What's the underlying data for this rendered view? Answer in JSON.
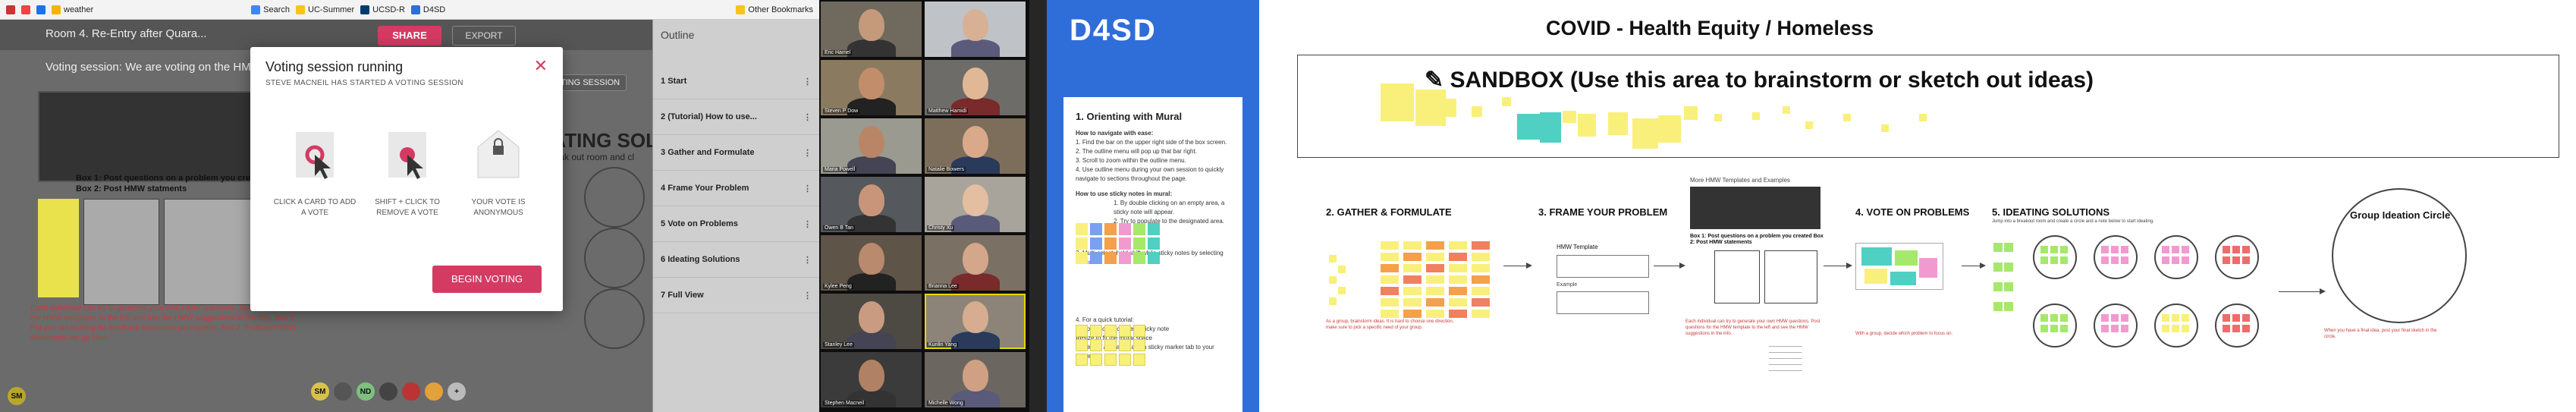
{
  "browser": {
    "bookmarks": [
      "weather",
      "Search",
      "UC-Summer",
      "UCSD-R",
      "D4SD"
    ],
    "other_bookmarks": "Other Bookmarks"
  },
  "mural_left": {
    "room_title": "Room 4. Re-Entry after Quara...",
    "share_label": "SHARE",
    "export_label": "EXPORT",
    "voting_banner": "Voting session: We are voting on the HMW ...",
    "voting_session_btn": "VOTING SESSION",
    "ideating_text": "EATING SOLU",
    "breakout_text": "break out room and cl",
    "box_labels": [
      "Box 1: Post questions on a problem you create",
      "Box 2: Post HMW statments"
    ],
    "red_note": "Each individual can try to generate your own HMW questions. Now vote Select the HMW templates to the left and use the HMW suggestions in the info. Box 1: Put you are looking for feedback from other participants. Box 2: Finalized HMW statements we go here",
    "avatars": [
      "SM",
      "",
      "ND",
      "",
      "",
      "",
      "+"
    ],
    "user_initials": "SM"
  },
  "outline": {
    "title": "Outline",
    "items": [
      "Start",
      "(Tutorial) How to use...",
      "Gather and Formulate",
      "Frame Your Problem",
      "Vote on Problems",
      "Ideating Solutions",
      "Full View"
    ],
    "numbers": [
      "1",
      "2",
      "3",
      "4",
      "5",
      "6",
      "7"
    ]
  },
  "modal": {
    "title": "Voting session running",
    "subtitle": "STEVE MACNEIL HAS STARTED A VOTING SESSION",
    "close_icon": "close-icon",
    "options": [
      {
        "label": "CLICK A CARD TO ADD A VOTE",
        "icon": "click-card-icon"
      },
      {
        "label": "SHIFT + CLICK TO REMOVE A VOTE",
        "icon": "shift-click-icon"
      },
      {
        "label": "YOUR VOTE IS ANONYMOUS",
        "icon": "anonymous-envelope-icon"
      }
    ],
    "begin_label": "BEGIN VOTING"
  },
  "gallery": {
    "participants": [
      "Eric Hamel",
      "",
      "Steven P Dow",
      "Matthew Hamidi",
      "Maria Powell",
      "Natalie Bowers",
      "Owen B Tan",
      "Christy Xu",
      "Kylee Peng",
      "Brianna Lee",
      "Stanley Lee",
      "Kunlin Yang",
      "Stephen Macneil",
      "Michelle Wong"
    ]
  },
  "mural_right": {
    "logo": "D4SD",
    "main_title": "COVID - Health Equity / Homeless",
    "sandbox_title": "SANDBOX (Use this area to brainstorm or sketch out ideas)",
    "orienting_title": "1. Orienting with Mural",
    "orienting_lines": [
      "How to navigate with ease:",
      "1. Find the bar on the upper right side of the box screen.",
      "2. The outline menu will pop up that bar right.",
      "3. Scroll to zoom within the outline menu.",
      "4. Use outline menu during your own session to quickly navigate to sections throughout the page.",
      "How to use sticky notes in mural:",
      "1. By double clicking on an empty area, a sticky note will appear.",
      "2. Try to populate to the designated area.",
      "3. Multi-select: hold shift while sticky notes by selecting the cover.",
      "4. For a quick tutorial:",
      "Double click to create a sticky note",
      "Resize to fit the mural space",
      "Move it to a location and a sticky marker tab to your content."
    ],
    "sections": {
      "gather": "2. GATHER & FORMULATE",
      "frame": "3. FRAME YOUR PROBLEM",
      "vote": "4. VOTE ON PROBLEMS",
      "ideate": "5. IDEATING SOLUTIONS",
      "group_circle": "Group Ideation Circle"
    },
    "frame_sub": "More HMW Templates and Examples",
    "hmw_template": "HMW Template",
    "example_label": "Example",
    "ideate_sub": "Jump into a breakout room and create a circle and a note below to start ideating.",
    "box_caption": "Box 1: Post questions on a problem you created Box 2: Post HMW statements",
    "colors": {
      "blue": "#2f6dd9",
      "accent": "#d43b63",
      "sticky_yellow": "#f8f07a",
      "sticky_teal": "#4fd0c3",
      "sticky_green": "#a6e86b",
      "sticky_pink": "#f29ad0"
    }
  }
}
